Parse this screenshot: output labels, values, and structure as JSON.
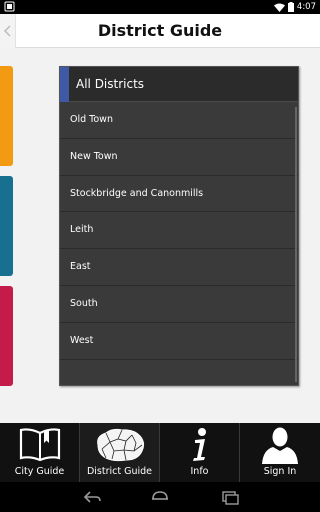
{
  "status_bar": {
    "time": "4:07",
    "icons": [
      "notification-icon",
      "wifi-icon",
      "battery-icon"
    ]
  },
  "action_bar": {
    "title": "District Guide"
  },
  "side_tiles": {
    "colors": [
      "#f39a13",
      "#17708f",
      "#c51b4b"
    ]
  },
  "district_panel": {
    "header": "All Districts",
    "accent_color": "#3e5aa6",
    "items": [
      {
        "label": "Old Town"
      },
      {
        "label": "New Town"
      },
      {
        "label": "Stockbridge and Canonmills"
      },
      {
        "label": "Leith"
      },
      {
        "label": "East"
      },
      {
        "label": "South"
      },
      {
        "label": "West"
      }
    ]
  },
  "tab_bar": {
    "tabs": [
      {
        "label": "City Guide",
        "icon": "book-icon"
      },
      {
        "label": "District Guide",
        "icon": "district-map-icon",
        "active": true
      },
      {
        "label": "Info",
        "icon": "info-icon"
      },
      {
        "label": "Sign In",
        "icon": "user-silhouette-icon"
      }
    ]
  },
  "nav_bar": {
    "icons": [
      "back-icon",
      "home-icon",
      "recents-icon"
    ]
  }
}
